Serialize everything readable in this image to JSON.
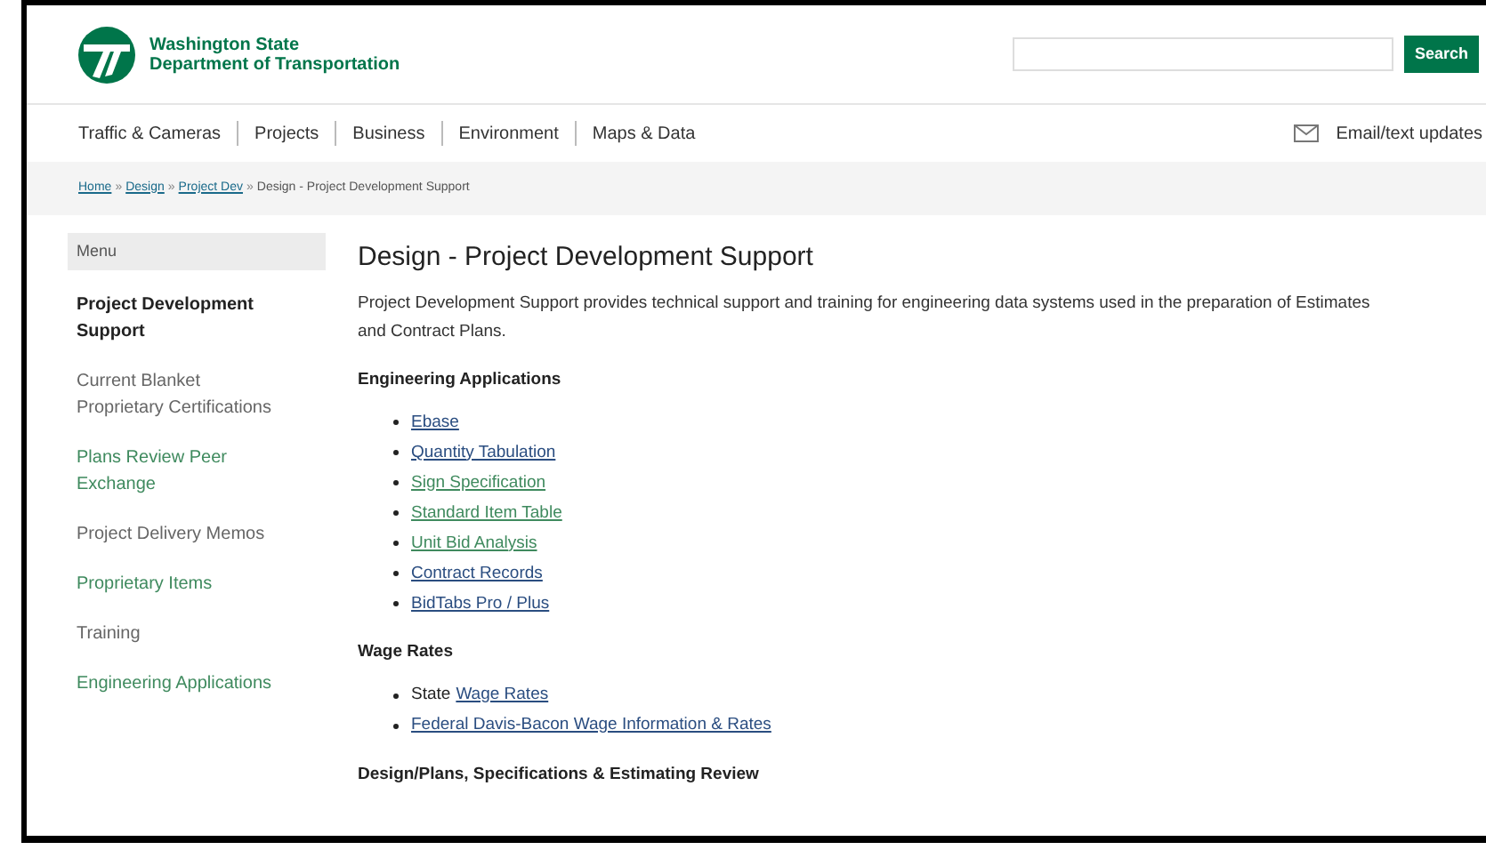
{
  "header": {
    "agency_line_1": "Washington State",
    "agency_line_2": "Department of Transportation",
    "search": {
      "button": "Search"
    }
  },
  "nav": {
    "items": [
      "Traffic & Cameras",
      "Projects",
      "Business",
      "Environment",
      "Maps & Data"
    ],
    "email_updates": "Email/text updates"
  },
  "breadcrumb": {
    "links": [
      "Home",
      "Design",
      "Project Dev"
    ],
    "separator": "»",
    "current": "Design - Project Development Support"
  },
  "sidebar": {
    "heading": "Menu",
    "items": [
      {
        "label": "Project Development Support",
        "selected": true
      },
      {
        "label": "Current Blanket Proprietary Certifications",
        "selected": false,
        "visited": false
      },
      {
        "label": "Plans Review Peer Exchange",
        "selected": false,
        "visited": true
      },
      {
        "label": "Project Delivery Memos",
        "selected": false,
        "visited": false
      },
      {
        "label": "Proprietary Items",
        "selected": false,
        "visited": true
      },
      {
        "label": "Training",
        "selected": false,
        "visited": false
      },
      {
        "label": "Engineering Applications",
        "selected": false,
        "visited": true
      }
    ]
  },
  "content": {
    "title": "Design - Project Development Support",
    "intro": "Project Development Support provides technical support and training for engineering data systems used in the preparation of Estimates and Contract Plans.",
    "sections": [
      {
        "heading": "Engineering Applications",
        "links": [
          {
            "label": "Ebase",
            "visited": false
          },
          {
            "label": "Quantity Tabulation",
            "visited": false
          },
          {
            "label": "Sign Specification",
            "visited": true
          },
          {
            "label": "Standard Item Table",
            "visited": true
          },
          {
            "label": "Unit Bid Analysis",
            "visited": true
          },
          {
            "label": "Contract Records",
            "visited": false
          },
          {
            "label": "BidTabs Pro / Plus",
            "visited": false
          }
        ]
      },
      {
        "heading": "Wage Rates",
        "links": [
          {
            "prefix": "State",
            "label": "Wage Rates",
            "visited": false
          },
          {
            "label": "Federal Davis-Bacon Wage Information & Rates",
            "visited": false
          }
        ]
      },
      {
        "heading": "Design/Plans, Specifications & Estimating Review"
      }
    ]
  }
}
